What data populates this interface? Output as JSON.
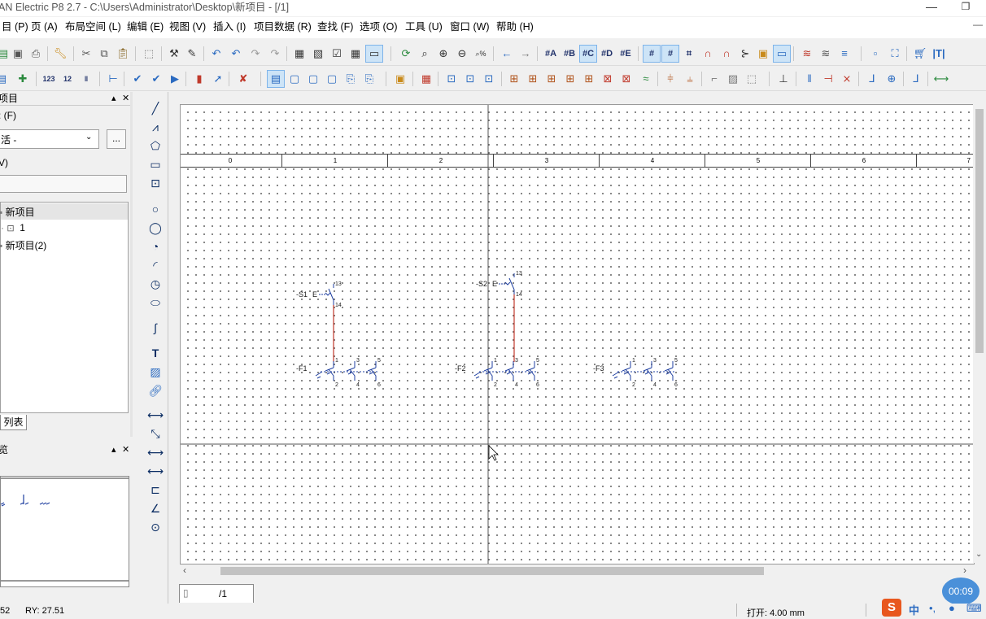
{
  "window": {
    "title": "AN Electric P8 2.7 - C:\\Users\\Administrator\\Desktop\\新项目 - [/1]",
    "min": "—",
    "restore": "❐",
    "close": "✕"
  },
  "menu": [
    {
      "label": "目 (P)"
    },
    {
      "label": "页 (A)"
    },
    {
      "label": "布局空间 (L)"
    },
    {
      "label": "编辑 (E)"
    },
    {
      "label": "视图 (V)"
    },
    {
      "label": "插入 (I)"
    },
    {
      "label": "项目数据 (R)"
    },
    {
      "label": "查找 (F)"
    },
    {
      "label": "选项 (O)"
    },
    {
      "label": "工具 (U)"
    },
    {
      "label": "窗口 (W)"
    },
    {
      "label": "帮助 (H)"
    }
  ],
  "left_panel": {
    "title": "项目",
    "line_f": ": (F)",
    "dropdown": "活 -",
    "dropdown_btn": "...",
    "line_v": "V)",
    "tree": [
      {
        "label": "新项目"
      },
      {
        "label": "1"
      },
      {
        "label": "新项目(2)"
      }
    ],
    "tab": "列表"
  },
  "preview_panel": {
    "title": "览"
  },
  "sheet": {
    "columns": [
      "0",
      "1",
      "2",
      "3",
      "4",
      "5",
      "6",
      "7"
    ],
    "devices": [
      {
        "tag": "-S1",
        "contact_top": "13",
        "contact_bot": "14"
      },
      {
        "tag": "-S2",
        "contact_top": "13",
        "contact_bot": "14"
      },
      {
        "tag": "-F1",
        "pins_top": [
          "1",
          "3",
          "5"
        ],
        "pins_bot": [
          "2",
          "4",
          "6"
        ]
      },
      {
        "tag": "-F2",
        "pins_top": [
          "1",
          "3",
          "5"
        ],
        "pins_bot": [
          "2",
          "4",
          "6"
        ]
      },
      {
        "tag": "-F3",
        "pins_top": [
          "1",
          "3",
          "5"
        ],
        "pins_bot": [
          "2",
          "4",
          "6"
        ]
      }
    ],
    "switch_label": "E"
  },
  "page_tab": "/1",
  "status": {
    "coords": "52",
    "ry": "RY: 27.51",
    "grid": "打开: 4.00 mm",
    "timer": "00:09",
    "ime_lang": "中"
  },
  "colors": {
    "accent": "#2a6ac0",
    "wire": "#c0392b",
    "timer": "#4a90d9"
  }
}
